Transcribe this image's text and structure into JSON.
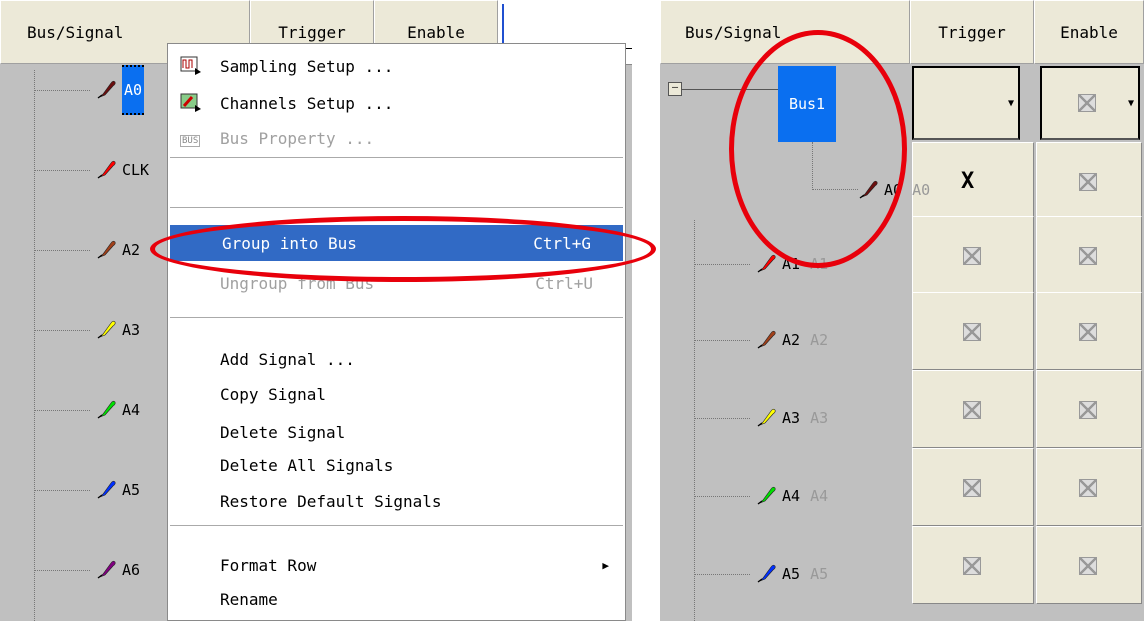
{
  "left": {
    "headers": {
      "bus_signal": "Bus/Signal",
      "trigger": "Trigger",
      "enable": "Enable"
    },
    "signals": [
      {
        "label": "A0",
        "color": "#6b0f0f",
        "selected": true
      },
      {
        "label": "CLK",
        "color": "#ff0000"
      },
      {
        "label": "A2",
        "color": "#a0401a"
      },
      {
        "label": "A3",
        "color": "#ffff00"
      },
      {
        "label": "A4",
        "color": "#00e000"
      },
      {
        "label": "A5",
        "color": "#0030ff"
      },
      {
        "label": "A6",
        "color": "#800080"
      }
    ],
    "menu": {
      "items": [
        {
          "label": "Sampling Setup ...",
          "icon": "sampling-icon"
        },
        {
          "label": "Channels Setup ...",
          "icon": "channels-icon"
        },
        {
          "label": "Bus Property ...",
          "icon": "bus-property-icon",
          "disabled": true
        },
        {
          "label": "Group into Bus",
          "shortcut": "Ctrl+G",
          "selected": true
        },
        {
          "label": "Ungroup from Bus",
          "shortcut": "Ctrl+U",
          "disabled": true
        },
        {
          "label": "Add Signal ..."
        },
        {
          "label": "Copy Signal"
        },
        {
          "label": "Delete Signal"
        },
        {
          "label": "Delete All Signals"
        },
        {
          "label": "Restore Default Signals"
        },
        {
          "label": "Format Row",
          "submenu": true
        },
        {
          "label": "Rename"
        }
      ],
      "bus_icon_text": "BUS"
    }
  },
  "right": {
    "headers": {
      "bus_signal": "Bus/Signal",
      "trigger": "Trigger",
      "enable": "Enable"
    },
    "bus": {
      "label": "Bus1",
      "expander": "—"
    },
    "trigger_x": "X",
    "signals": [
      {
        "label": "A0",
        "alias": "A0",
        "color": "#6b0f0f"
      },
      {
        "label": "A1",
        "alias": "A1",
        "color": "#ff0000"
      },
      {
        "label": "A2",
        "alias": "A2",
        "color": "#a0401a"
      },
      {
        "label": "A3",
        "alias": "A3",
        "color": "#ffff00"
      },
      {
        "label": "A4",
        "alias": "A4",
        "color": "#00e000"
      },
      {
        "label": "A5",
        "alias": "A5",
        "color": "#0030ff"
      }
    ]
  },
  "colors": {
    "highlight": "#316ac5",
    "annotation": "#e8000b",
    "selection": "#0a6ff0"
  }
}
